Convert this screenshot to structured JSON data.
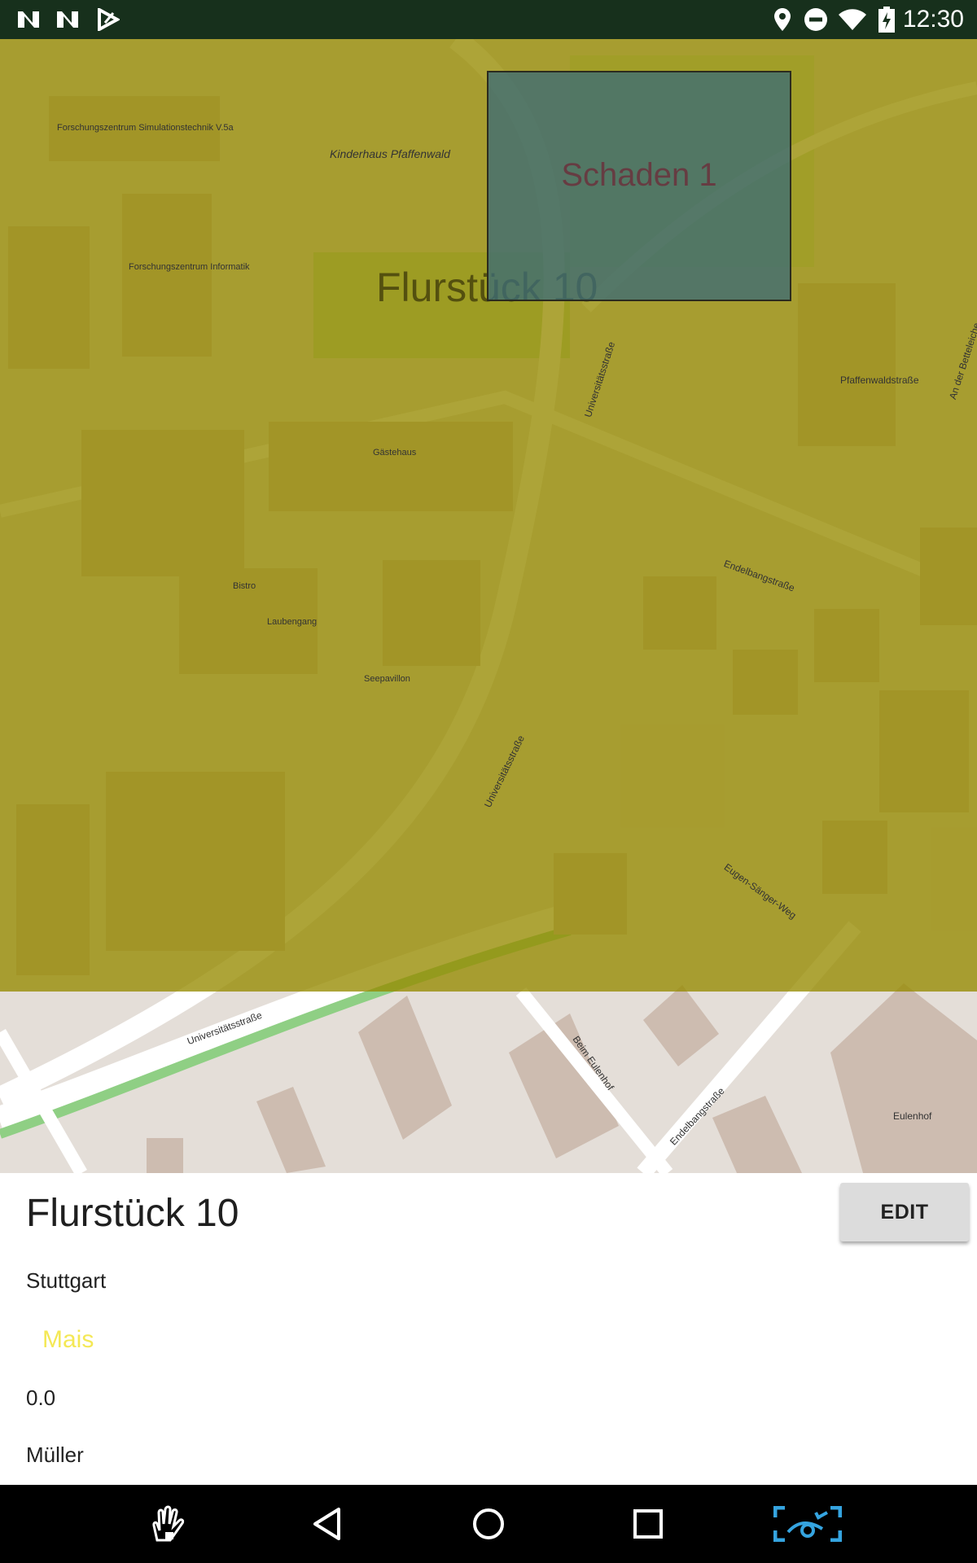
{
  "status_bar": {
    "time": "12:30",
    "left_icons": [
      "notification-n-icon",
      "notification-n-icon",
      "play-store-icon"
    ],
    "right_icons": [
      "location-icon",
      "do-not-disturb-icon",
      "wifi-icon",
      "battery-charging-icon"
    ]
  },
  "map": {
    "parcel_label": "Flurstück 10",
    "damage_label": "Schaden 1",
    "parcel_color": "#968a00",
    "damage_color": "#3c6c76",
    "street_labels": [
      "Universitätsstraße",
      "Universitätsstraße",
      "Universitätsstraße",
      "Endelbangstraße",
      "Endelbangstraße",
      "Beim Eulenhof",
      "Eugen-Sänger-Weg",
      "Pfaffenwaldstraße",
      "An der Betteleiche",
      "Eulenhof",
      "Kinderhaus Pfaffenwald",
      "Forschungszentrum Informatik",
      "Forschungszentrum Simulationstechnik V.5a",
      "Gästehaus",
      "Laubengang",
      "Bistro",
      "Seepavillon"
    ]
  },
  "sheet": {
    "title": "Flurstück 10",
    "edit_label": "EDIT",
    "city": "Stuttgart",
    "crop": "Mais",
    "crop_color": "#f4e855",
    "value": "0.0",
    "owner": "Müller"
  },
  "nav_bar": {
    "buttons": [
      "accessibility-hand-icon",
      "back-icon",
      "home-icon",
      "recents-icon",
      "screen-capture-icon"
    ]
  }
}
